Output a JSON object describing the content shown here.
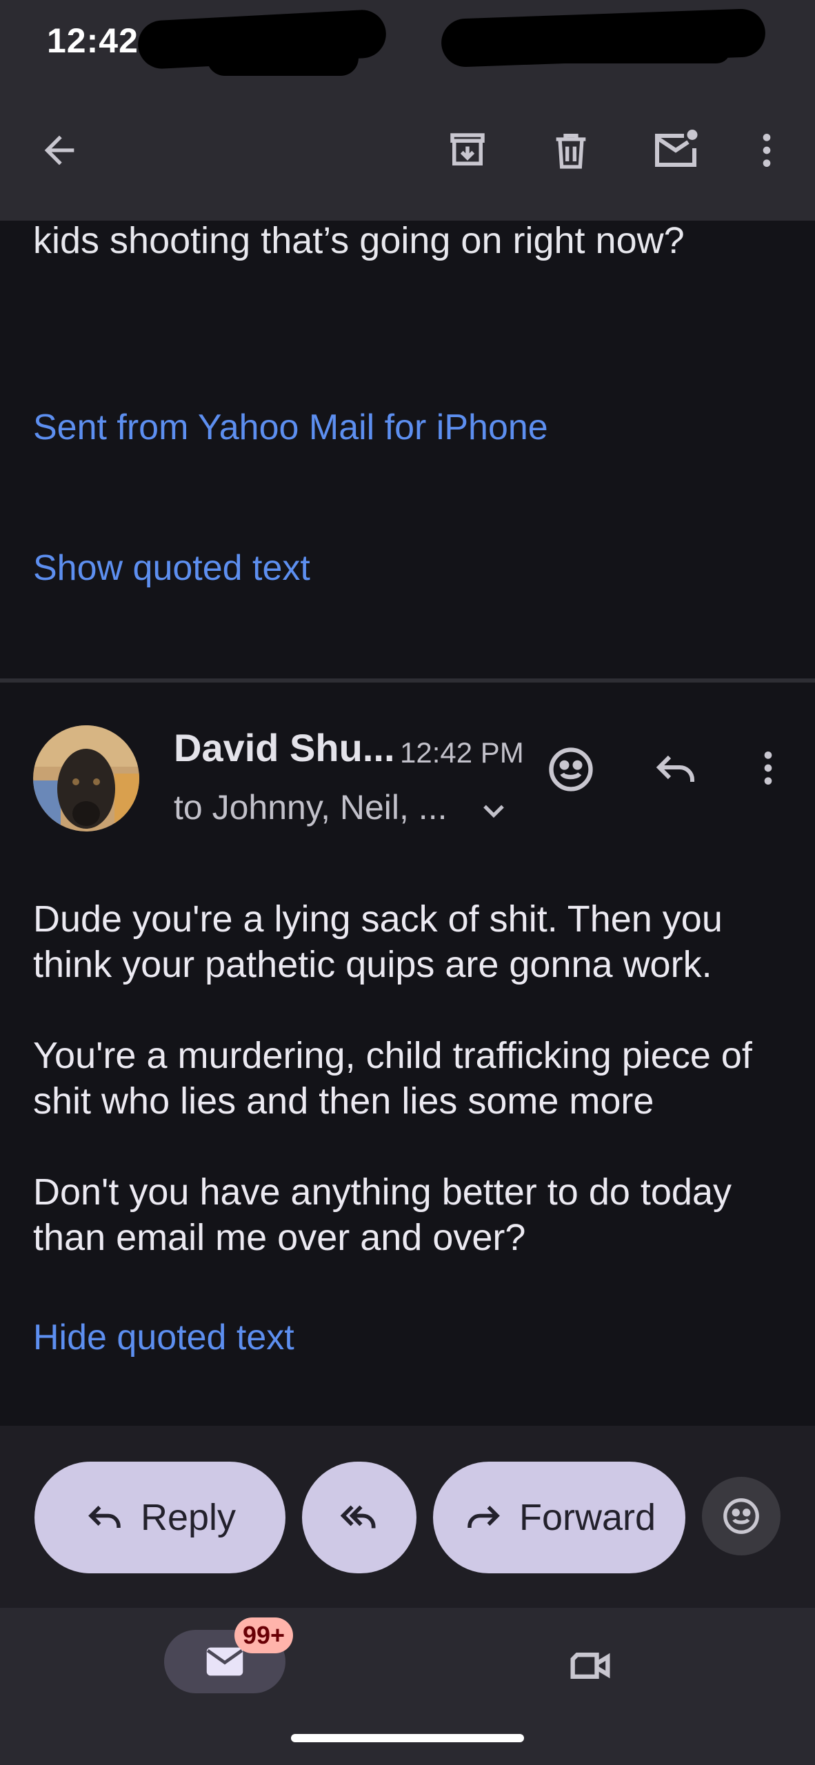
{
  "status_bar": {
    "time": "12:42"
  },
  "toolbar": {
    "back": "back-arrow-icon",
    "actions": [
      "archive-icon",
      "delete-icon",
      "mark-unread-icon",
      "more-vert-icon"
    ]
  },
  "message1": {
    "body_tail": "kids shooting that’s going on right now?",
    "signature": "Sent from Yahoo Mail for iPhone",
    "show_quoted": "Show quoted text"
  },
  "message2": {
    "sender": "David Shu...",
    "time": "12:42 PM",
    "recipients": "to Johnny, Neil, ...",
    "paragraphs": [
      "Dude you're a lying sack of shit. Then you think your pathetic quips are gonna work.",
      "You're a murdering, child trafficking piece of shit who lies and then lies some more",
      "Don't you have anything better to do today than email me over and over?"
    ],
    "hide_quoted": "Hide quoted text"
  },
  "action_bar": {
    "reply": "Reply",
    "forward": "Forward"
  },
  "bottom_nav": {
    "mail_badge": "99+"
  },
  "colors": {
    "background": "#131318",
    "toolbar": "#2c2b31",
    "link": "#5d8ff0",
    "pill": "#cfc9e6",
    "badge": "#ffb4ab"
  }
}
